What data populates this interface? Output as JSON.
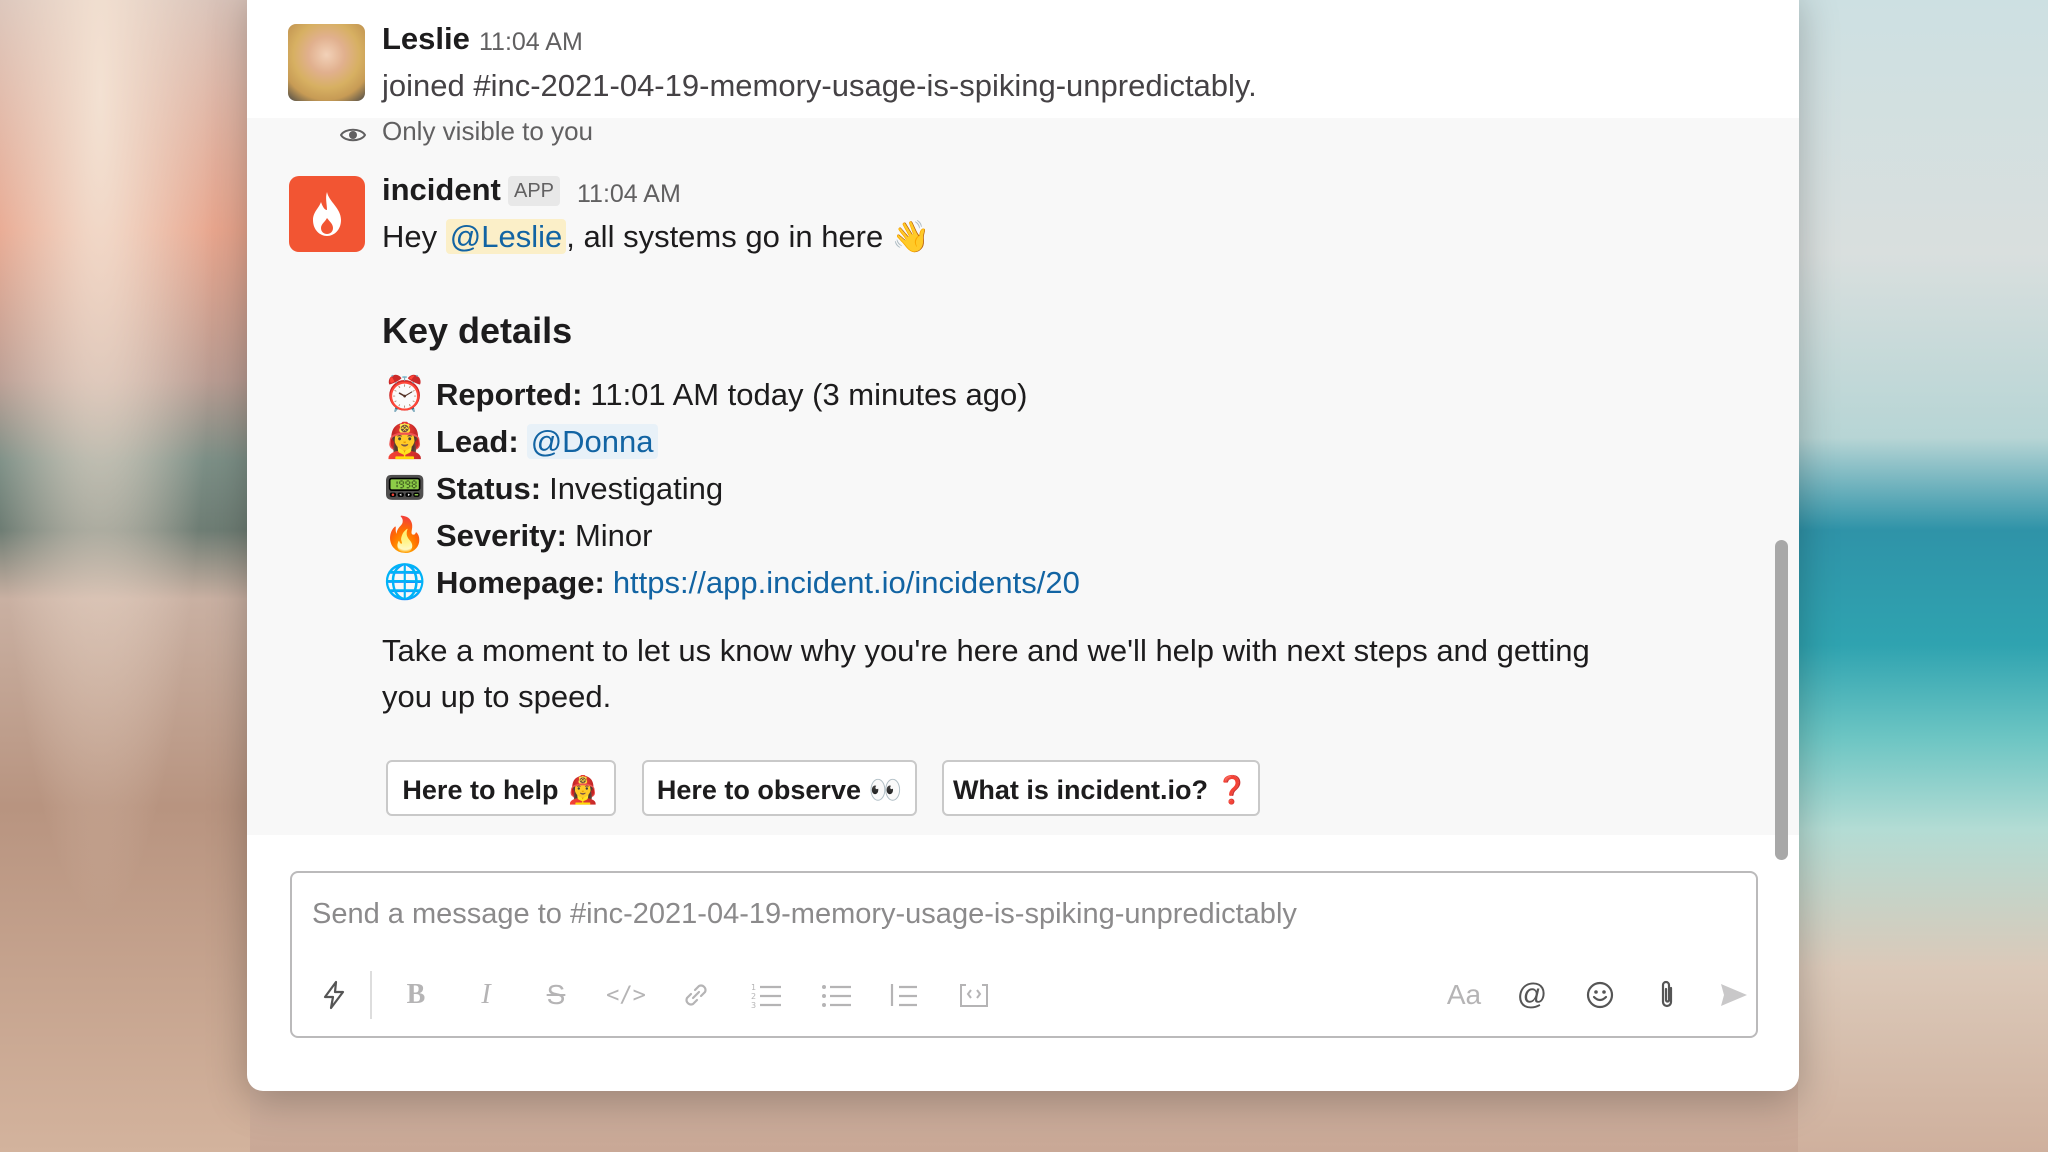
{
  "colors": {
    "accent_link": "#1264a3",
    "mention_bg": "#fbefc8",
    "incident_brand": "#f25533",
    "ephemeral_bg": "#f8f8f8"
  },
  "join_message": {
    "author": "Leslie",
    "time": "11:04 AM",
    "text": "joined #inc-2021-04-19-memory-usage-is-spiking-unpredictably."
  },
  "ephemeral": {
    "visibility_note": "Only visible to you",
    "author": "incident",
    "badge": "APP",
    "time": "11:04 AM",
    "greeting_prefix": "Hey ",
    "greeting_mention": "@Leslie",
    "greeting_suffix": ", all systems go in here",
    "greeting_emoji": "👋",
    "key_details_heading": "Key details",
    "details": [
      {
        "emoji": "⏰",
        "label": "Reported:",
        "value": "11:01 AM today (3 minutes ago)"
      },
      {
        "emoji": "👩‍🚒",
        "label": "Lead:",
        "value": "@Donna"
      },
      {
        "emoji": "📟",
        "label": "Status:",
        "value": "Investigating"
      },
      {
        "emoji": "🔥",
        "label": "Severity:",
        "value": "Minor"
      },
      {
        "emoji": "🌐",
        "label": "Homepage:",
        "value": "https://app.incident.io/incidents/20"
      }
    ],
    "blurb": "Take a moment to let us know why you're here and we'll help with next steps and getting you up to speed.",
    "buttons": [
      {
        "label": "Here to help 👩‍🚒"
      },
      {
        "label": "Here to observe 👀"
      },
      {
        "label": "What is incident.io? ❓"
      }
    ]
  },
  "composer": {
    "placeholder": "Send a message to #inc-2021-04-19-memory-usage-is-spiking-unpredictably",
    "value": "",
    "format_toggle_label": "Aa",
    "icons": [
      "shortcuts-icon",
      "bold-icon",
      "italic-icon",
      "strikethrough-icon",
      "code-icon",
      "link-icon",
      "numbered-list-icon",
      "bulleted-list-icon",
      "blockquote-icon",
      "code-block-icon",
      "format-toggle-icon",
      "mention-icon",
      "emoji-icon",
      "attachment-icon",
      "send-icon"
    ]
  }
}
